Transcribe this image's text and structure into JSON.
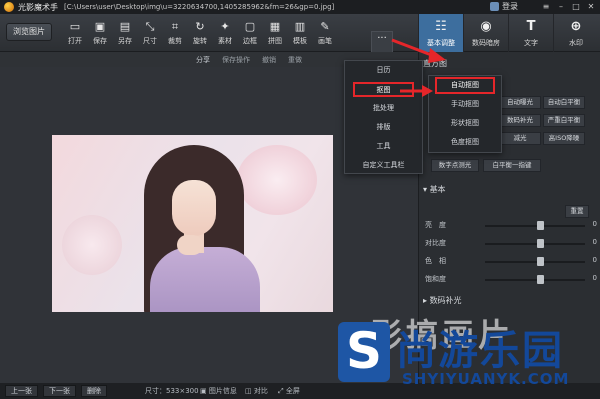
{
  "app": {
    "name": "光影魔术手",
    "path": "[C:\\Users\\user\\Desktop\\img\\u=3220634700,1405285962&fm=26&gp=0.jpg]",
    "login_label": "登录"
  },
  "toolbar": {
    "browse_label": "浏览图片",
    "tools": [
      {
        "label": "打开",
        "icon": "folder-icon"
      },
      {
        "label": "保存",
        "icon": "save-icon"
      },
      {
        "label": "另存",
        "icon": "save-as-icon"
      },
      {
        "label": "尺寸",
        "icon": "resize-icon"
      },
      {
        "label": "裁剪",
        "icon": "crop-icon"
      },
      {
        "label": "旋转",
        "icon": "rotate-icon"
      },
      {
        "label": "素材",
        "icon": "material-icon"
      },
      {
        "label": "边框",
        "icon": "frame-icon"
      },
      {
        "label": "拼图",
        "icon": "collage-icon"
      },
      {
        "label": "模板",
        "icon": "template-icon"
      },
      {
        "label": "画笔",
        "icon": "brush-icon"
      }
    ],
    "more_label": "···"
  },
  "right_tabs": [
    {
      "label": "基本调整",
      "icon": "adjust-icon",
      "active": true
    },
    {
      "label": "数码暗房",
      "icon": "camera-icon",
      "active": false
    },
    {
      "label": "文字",
      "icon": "text-icon",
      "active": false
    },
    {
      "label": "水印",
      "icon": "watermark-icon",
      "active": false
    }
  ],
  "subbar": {
    "share": "分享",
    "save_op": "保存操作",
    "undo": "撤销",
    "redo": "重做"
  },
  "menu": {
    "items": [
      "日历",
      "抠图",
      "批处理",
      "排版",
      "工具",
      "自定义工具栏"
    ],
    "highlighted_index": 1
  },
  "submenu": {
    "items": [
      "自动抠图",
      "手动抠图",
      "形状抠图",
      "色度抠图"
    ],
    "highlighted_index": 0
  },
  "panel": {
    "histogram_title": "直方图",
    "auto_buttons": [
      "自动曝光",
      "自动白平衡",
      "数码补光",
      "严重白平衡",
      "减光",
      "高ISO降噪"
    ],
    "digital_fill": "数字点测光",
    "white_balance": "白平衡一指键",
    "basic_title": "基本",
    "reset_label": "重置",
    "sliders": [
      {
        "label": "亮　度",
        "value": "0",
        "pos": 0.55
      },
      {
        "label": "对比度",
        "value": "0",
        "pos": 0.55
      },
      {
        "label": "色　相",
        "value": "0",
        "pos": 0.55
      },
      {
        "label": "饱和度",
        "value": "0",
        "pos": 0.55
      }
    ],
    "digital_light_title": "数码补光"
  },
  "bottom": {
    "prev": "上一张",
    "next": "下一张",
    "delete": "删除",
    "size_info": "尺寸：533×300",
    "image_info": "图片信息",
    "compare": "对比",
    "fullscreen": "全屏"
  },
  "watermark": {
    "ghost": "影搞画片",
    "s_letter": "S",
    "brand": "尚游乐园",
    "site": "SHYIYUANYK.COM"
  },
  "colors": {
    "accent": "#3d6e9e",
    "highlight_red": "#e5262a",
    "brand_blue": "#13489a"
  }
}
